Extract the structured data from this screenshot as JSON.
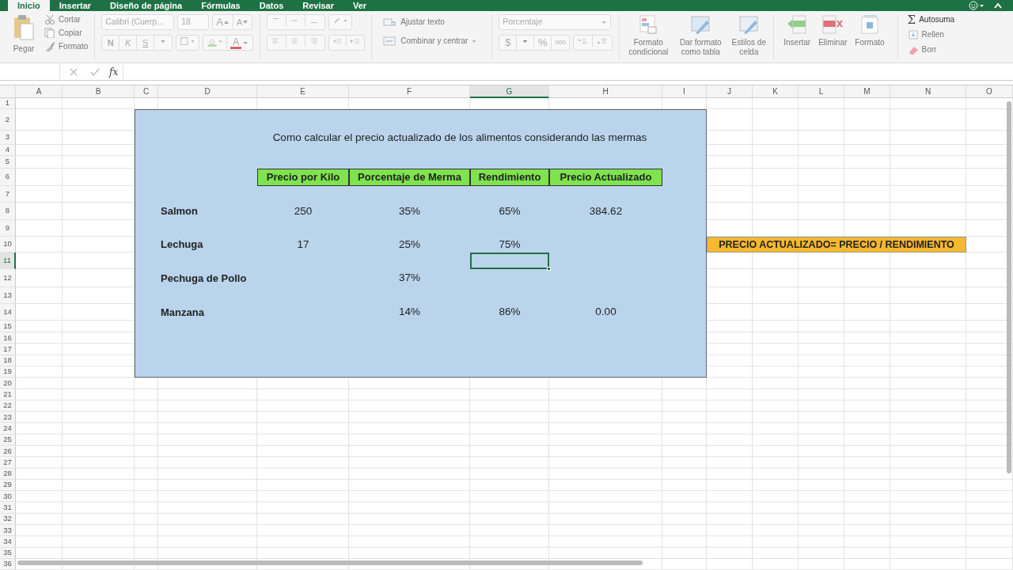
{
  "tabs": [
    {
      "label": "Inicio",
      "selected": true
    },
    {
      "label": "Insertar",
      "selected": false
    },
    {
      "label": "Diseño de página",
      "selected": false
    },
    {
      "label": "Fórmulas",
      "selected": false
    },
    {
      "label": "Datos",
      "selected": false
    },
    {
      "label": "Revisar",
      "selected": false
    },
    {
      "label": "Ver",
      "selected": false
    }
  ],
  "ribbon": {
    "clipboard": {
      "paste": "Pegar",
      "cut": "Cortar",
      "copy": "Copiar",
      "format_painter": "Formato"
    },
    "font": {
      "name": "Calibri (Cuerp...",
      "size": "18",
      "grow": "A",
      "shrink": "A",
      "bold": "N",
      "italic": "K",
      "underline": "S",
      "font_color_label": "A"
    },
    "alignment": {
      "wrap": "Ajustar texto",
      "merge": "Combinar y centrar"
    },
    "number": {
      "format": "Porcentaje",
      "currency": "$",
      "percent": "%",
      "thousands": "000"
    },
    "styles": [
      "Formato condicional",
      "Dar formato como tabla",
      "Estilos de celda"
    ],
    "cells": [
      "Insertar",
      "Eliminar",
      "Formato"
    ],
    "autosum_symbol": "Σ",
    "editing": [
      "Autosuma",
      "Rellen",
      "Borr"
    ]
  },
  "formula_bar": {
    "function_label": "fx"
  },
  "sheet": {
    "columns": [
      {
        "label": "A",
        "selected": false
      },
      {
        "label": "B",
        "selected": false
      },
      {
        "label": "C",
        "selected": false
      },
      {
        "label": "D",
        "selected": false
      },
      {
        "label": "E",
        "selected": false
      },
      {
        "label": "F",
        "selected": false
      },
      {
        "label": "G",
        "selected": true
      },
      {
        "label": "H",
        "selected": false
      },
      {
        "label": "I",
        "selected": false
      },
      {
        "label": "J",
        "selected": false
      },
      {
        "label": "K",
        "selected": false
      },
      {
        "label": "L",
        "selected": false
      },
      {
        "label": "M",
        "selected": false
      },
      {
        "label": "N",
        "selected": false
      },
      {
        "label": "O",
        "selected": false
      }
    ],
    "rows": [
      {
        "label": "1",
        "selected": false
      },
      {
        "label": "2",
        "selected": false
      },
      {
        "label": "3",
        "selected": false
      },
      {
        "label": "4",
        "selected": false
      },
      {
        "label": "5",
        "selected": false
      },
      {
        "label": "6",
        "selected": false
      },
      {
        "label": "7",
        "selected": false
      },
      {
        "label": "8",
        "selected": false
      },
      {
        "label": "9",
        "selected": false
      },
      {
        "label": "10",
        "selected": false
      },
      {
        "label": "11",
        "selected": true
      },
      {
        "label": "12",
        "selected": false
      },
      {
        "label": "13",
        "selected": false
      },
      {
        "label": "14",
        "selected": false
      },
      {
        "label": "15",
        "selected": false
      },
      {
        "label": "16",
        "selected": false
      },
      {
        "label": "17",
        "selected": false
      },
      {
        "label": "18",
        "selected": false
      },
      {
        "label": "19",
        "selected": false
      },
      {
        "label": "20",
        "selected": false
      },
      {
        "label": "21",
        "selected": false
      },
      {
        "label": "22",
        "selected": false
      },
      {
        "label": "23",
        "selected": false
      },
      {
        "label": "24",
        "selected": false
      },
      {
        "label": "25",
        "selected": false
      },
      {
        "label": "26",
        "selected": false
      },
      {
        "label": "27",
        "selected": false
      },
      {
        "label": "28",
        "selected": false
      },
      {
        "label": "29",
        "selected": false
      },
      {
        "label": "30",
        "selected": false
      },
      {
        "label": "31",
        "selected": false
      },
      {
        "label": "32",
        "selected": false
      },
      {
        "label": "33",
        "selected": false
      },
      {
        "label": "34",
        "selected": false
      },
      {
        "label": "35",
        "selected": false
      },
      {
        "label": "36",
        "selected": false
      }
    ]
  },
  "table": {
    "title": "Como calcular el precio actualizado de los alimentos considerando las mermas",
    "headers": [
      "Precio por Kilo",
      "Porcentaje de Merma",
      "Rendimiento",
      "Precio Actualizado"
    ],
    "items": [
      {
        "name": "Salmon",
        "values": {
          "price": "250",
          "waste": "35%",
          "yield": "65%",
          "updated": "384.62"
        }
      },
      {
        "name": "Lechuga",
        "values": {
          "price": "17",
          "waste": "25%",
          "yield": "75%"
        }
      },
      {
        "name": "Pechuga de Pollo",
        "values": {
          "waste": "37%"
        }
      },
      {
        "name": "Manzana",
        "values": {
          "waste": "14%",
          "yield": "86%",
          "updated": "0.00"
        }
      }
    ]
  },
  "note": "PRECIO ACTUALIZADO= PRECIO / RENDIMIENTO"
}
